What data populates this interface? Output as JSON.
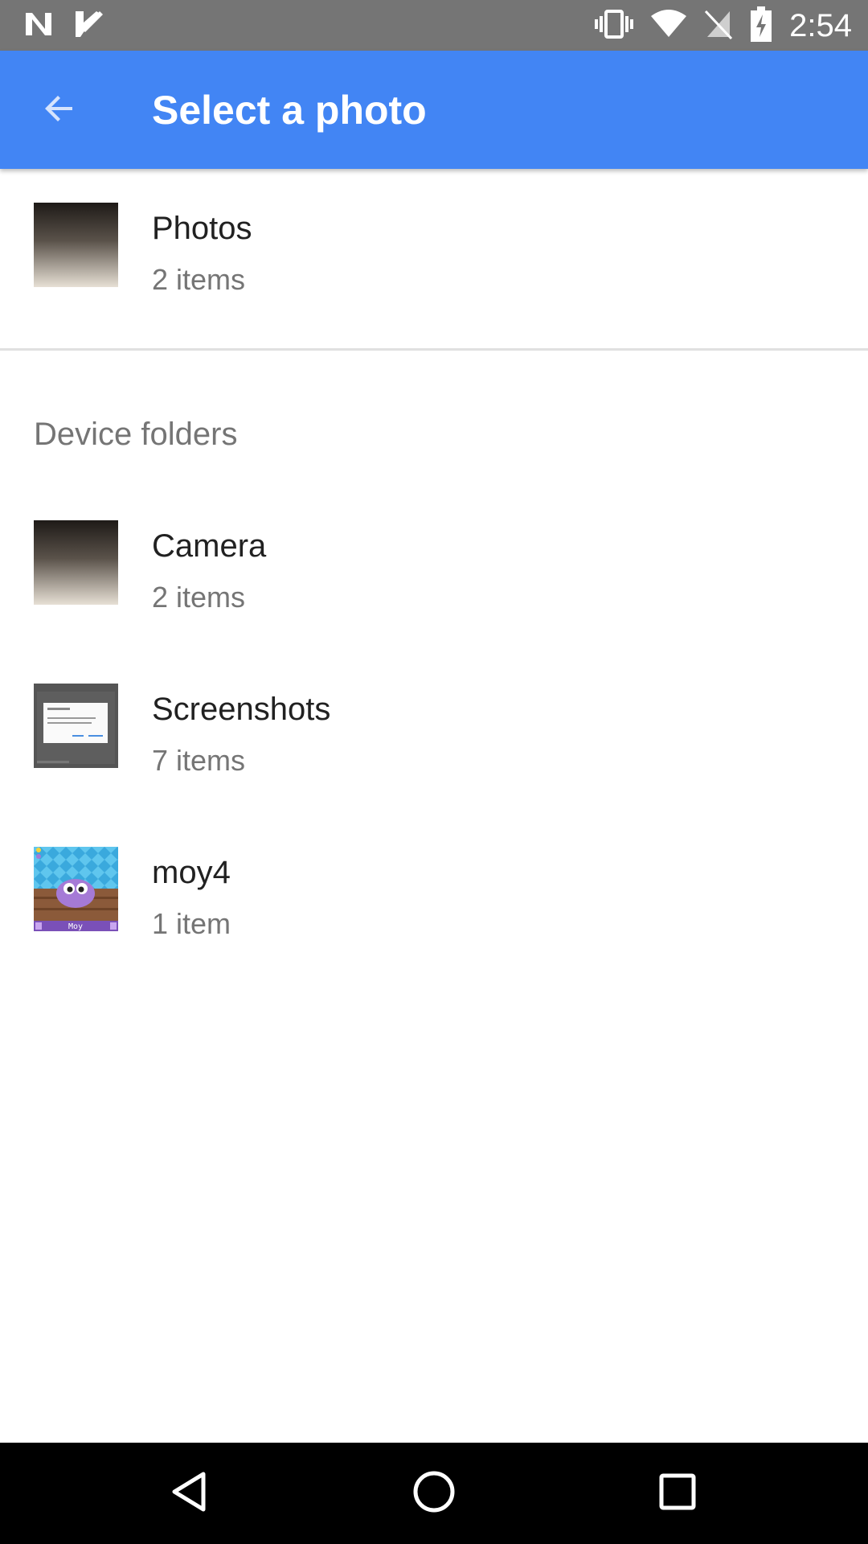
{
  "status_bar": {
    "time": "2:54",
    "left_icons": [
      "n-notification-icon",
      "check-notification-icon"
    ],
    "right_icons": [
      "vibrate-icon",
      "wifi-icon",
      "no-sim-icon",
      "battery-charging-icon"
    ]
  },
  "app_bar": {
    "title": "Select a photo",
    "back_icon": "arrow-back-icon",
    "color": "#4285f4"
  },
  "top_album": {
    "title": "Photos",
    "subtitle": "2 items",
    "thumb": "gradient-photo"
  },
  "section": {
    "header": "Device folders"
  },
  "folders": [
    {
      "title": "Camera",
      "subtitle": "2 items",
      "thumb": "gradient-photo"
    },
    {
      "title": "Screenshots",
      "subtitle": "7 items",
      "thumb": "screenshot-dialog"
    },
    {
      "title": "moy4",
      "subtitle": "1 item",
      "thumb": "moy-pet-game",
      "thumb_text": "Moy"
    }
  ],
  "nav_bar": {
    "icons": [
      "back-triangle-icon",
      "home-circle-icon",
      "recents-square-icon"
    ]
  }
}
